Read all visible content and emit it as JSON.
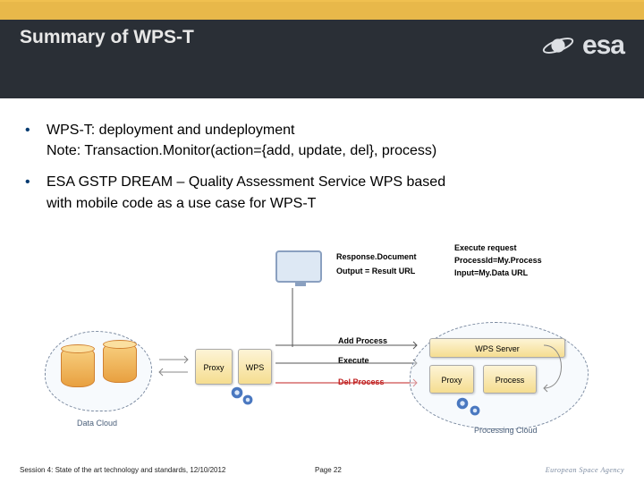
{
  "header": {
    "title": "Summary of WPS-T",
    "logo_text": "esa"
  },
  "bullets": {
    "b1": {
      "line1": "WPS-T: deployment and undeployment",
      "line2": "Note: Transaction.Monitor(action={add, update, del}, process)"
    },
    "b2": {
      "line1": "ESA GSTP DREAM – Quality Assessment Service WPS based",
      "line2": "with mobile code as a use case for WPS-T"
    }
  },
  "diagram": {
    "response_doc": "Response.Document",
    "output": "Output = Result URL",
    "execute_req": "Execute request",
    "process_id": "ProcessId=My.Process",
    "input": "Input=My.Data URL",
    "proxy": "Proxy",
    "wps": "WPS",
    "add_process": "Add Process",
    "execute": "Execute",
    "del_process": "Del Process",
    "wps_server": "WPS Server",
    "process": "Process",
    "data_cloud": "Data Cloud",
    "processing_cloud": "Processing Cloud"
  },
  "footer": {
    "session": "Session 4: State of the art technology and standards, 12/10/2012",
    "page": "Page 22",
    "agency": "European Space Agency"
  }
}
